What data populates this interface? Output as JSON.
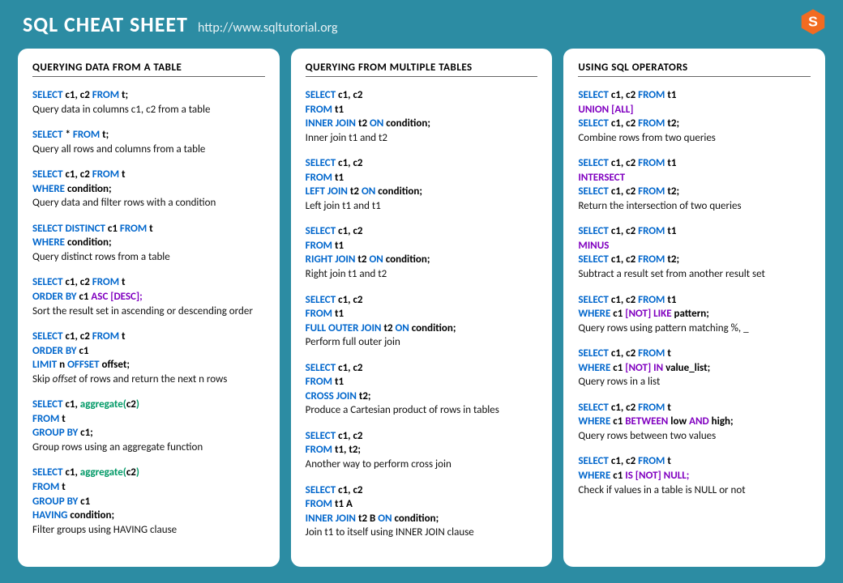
{
  "header": {
    "title": "SQL CHEAT SHEET",
    "url": "http://www.sqltutorial.org"
  },
  "columns": [
    {
      "heading": "QUERYING DATA FROM A TABLE",
      "blocks": [
        {
          "code": [
            [
              {
                "t": "SELECT ",
                "c": "kw"
              },
              {
                "t": "c1, c2 ",
                "c": "blk"
              },
              {
                "t": "FROM ",
                "c": "kw"
              },
              {
                "t": "t;",
                "c": "blk"
              }
            ]
          ],
          "desc": "Query data in columns c1, c2 from a table"
        },
        {
          "code": [
            [
              {
                "t": "SELECT ",
                "c": "kw"
              },
              {
                "t": "* ",
                "c": "blk"
              },
              {
                "t": "FROM ",
                "c": "kw"
              },
              {
                "t": "t;",
                "c": "blk"
              }
            ]
          ],
          "desc": "Query all rows and columns from a table"
        },
        {
          "code": [
            [
              {
                "t": "SELECT ",
                "c": "kw"
              },
              {
                "t": "c1, c2 ",
                "c": "blk"
              },
              {
                "t": "FROM ",
                "c": "kw"
              },
              {
                "t": "t",
                "c": "blk"
              }
            ],
            [
              {
                "t": "WHERE ",
                "c": "kw"
              },
              {
                "t": "condition;",
                "c": "blk"
              }
            ]
          ],
          "desc": "Query data and filter rows with a condition"
        },
        {
          "code": [
            [
              {
                "t": "SELECT DISTINCT ",
                "c": "kw"
              },
              {
                "t": "c1 ",
                "c": "blk"
              },
              {
                "t": "FROM ",
                "c": "kw"
              },
              {
                "t": "t",
                "c": "blk"
              }
            ],
            [
              {
                "t": "WHERE ",
                "c": "kw"
              },
              {
                "t": "condition;",
                "c": "blk"
              }
            ]
          ],
          "desc": "Query distinct rows from a table"
        },
        {
          "code": [
            [
              {
                "t": "SELECT ",
                "c": "kw"
              },
              {
                "t": "c1, c2 ",
                "c": "blk"
              },
              {
                "t": "FROM ",
                "c": "kw"
              },
              {
                "t": "t",
                "c": "blk"
              }
            ],
            [
              {
                "t": "ORDER BY ",
                "c": "kw"
              },
              {
                "t": "c1 ",
                "c": "blk"
              },
              {
                "t": "ASC [DESC];",
                "c": "op"
              }
            ]
          ],
          "desc": "Sort the result set in ascending or descending order"
        },
        {
          "code": [
            [
              {
                "t": "SELECT ",
                "c": "kw"
              },
              {
                "t": "c1, c2 ",
                "c": "blk"
              },
              {
                "t": "FROM ",
                "c": "kw"
              },
              {
                "t": "t",
                "c": "blk"
              }
            ],
            [
              {
                "t": "ORDER BY ",
                "c": "kw"
              },
              {
                "t": "c1",
                "c": "blk"
              }
            ],
            [
              {
                "t": "LIMIT ",
                "c": "kw"
              },
              {
                "t": "n ",
                "c": "blk"
              },
              {
                "t": "OFFSET ",
                "c": "kw"
              },
              {
                "t": "offset;",
                "c": "blk"
              }
            ]
          ],
          "desc": "Skip <em>offset</em> of rows and return the next n rows"
        },
        {
          "code": [
            [
              {
                "t": "SELECT ",
                "c": "kw"
              },
              {
                "t": "c1, ",
                "c": "blk"
              },
              {
                "t": "aggregate(",
                "c": "fn"
              },
              {
                "t": "c2",
                "c": "blk"
              },
              {
                "t": ")",
                "c": "fn"
              }
            ],
            [
              {
                "t": "FROM ",
                "c": "kw"
              },
              {
                "t": "t",
                "c": "blk"
              }
            ],
            [
              {
                "t": "GROUP BY ",
                "c": "kw"
              },
              {
                "t": "c1;",
                "c": "blk"
              }
            ]
          ],
          "desc": "Group rows using an aggregate function"
        },
        {
          "code": [
            [
              {
                "t": "SELECT ",
                "c": "kw"
              },
              {
                "t": "c1, ",
                "c": "blk"
              },
              {
                "t": "aggregate(",
                "c": "fn"
              },
              {
                "t": "c2",
                "c": "blk"
              },
              {
                "t": ")",
                "c": "fn"
              }
            ],
            [
              {
                "t": "FROM ",
                "c": "kw"
              },
              {
                "t": "t",
                "c": "blk"
              }
            ],
            [
              {
                "t": "GROUP BY ",
                "c": "kw"
              },
              {
                "t": "c1",
                "c": "blk"
              }
            ],
            [
              {
                "t": "HAVING ",
                "c": "kw"
              },
              {
                "t": "condition;",
                "c": "blk"
              }
            ]
          ],
          "desc": "Filter groups using HAVING clause"
        }
      ]
    },
    {
      "heading": "QUERYING FROM MULTIPLE TABLES",
      "blocks": [
        {
          "code": [
            [
              {
                "t": "SELECT ",
                "c": "kw"
              },
              {
                "t": "c1, c2",
                "c": "blk"
              }
            ],
            [
              {
                "t": "FROM ",
                "c": "kw"
              },
              {
                "t": "t1",
                "c": "blk"
              }
            ],
            [
              {
                "t": "INNER JOIN ",
                "c": "kw"
              },
              {
                "t": "t2 ",
                "c": "blk"
              },
              {
                "t": "ON ",
                "c": "kw"
              },
              {
                "t": "condition;",
                "c": "blk"
              }
            ]
          ],
          "desc": "Inner join t1 and t2"
        },
        {
          "code": [
            [
              {
                "t": "SELECT ",
                "c": "kw"
              },
              {
                "t": "c1, c2",
                "c": "blk"
              }
            ],
            [
              {
                "t": "FROM ",
                "c": "kw"
              },
              {
                "t": "t1",
                "c": "blk"
              }
            ],
            [
              {
                "t": "LEFT JOIN ",
                "c": "kw"
              },
              {
                "t": "t2 ",
                "c": "blk"
              },
              {
                "t": "ON ",
                "c": "kw"
              },
              {
                "t": "condition;",
                "c": "blk"
              }
            ]
          ],
          "desc": "Left join t1 and t1"
        },
        {
          "code": [
            [
              {
                "t": "SELECT ",
                "c": "kw"
              },
              {
                "t": "c1, c2",
                "c": "blk"
              }
            ],
            [
              {
                "t": "FROM ",
                "c": "kw"
              },
              {
                "t": "t1",
                "c": "blk"
              }
            ],
            [
              {
                "t": "RIGHT JOIN ",
                "c": "kw"
              },
              {
                "t": "t2 ",
                "c": "blk"
              },
              {
                "t": "ON ",
                "c": "kw"
              },
              {
                "t": "condition;",
                "c": "blk"
              }
            ]
          ],
          "desc": "Right join t1 and t2"
        },
        {
          "code": [
            [
              {
                "t": "SELECT ",
                "c": "kw"
              },
              {
                "t": "c1, c2",
                "c": "blk"
              }
            ],
            [
              {
                "t": "FROM ",
                "c": "kw"
              },
              {
                "t": "t1",
                "c": "blk"
              }
            ],
            [
              {
                "t": "FULL OUTER JOIN ",
                "c": "kw"
              },
              {
                "t": "t2 ",
                "c": "blk"
              },
              {
                "t": "ON ",
                "c": "kw"
              },
              {
                "t": "condition;",
                "c": "blk"
              }
            ]
          ],
          "desc": "Perform full outer join"
        },
        {
          "code": [
            [
              {
                "t": "SELECT ",
                "c": "kw"
              },
              {
                "t": "c1, c2",
                "c": "blk"
              }
            ],
            [
              {
                "t": "FROM ",
                "c": "kw"
              },
              {
                "t": "t1",
                "c": "blk"
              }
            ],
            [
              {
                "t": "CROSS JOIN ",
                "c": "kw"
              },
              {
                "t": "t2;",
                "c": "blk"
              }
            ]
          ],
          "desc": "Produce a Cartesian product of rows in tables"
        },
        {
          "code": [
            [
              {
                "t": "SELECT ",
                "c": "kw"
              },
              {
                "t": "c1, c2",
                "c": "blk"
              }
            ],
            [
              {
                "t": "FROM ",
                "c": "kw"
              },
              {
                "t": "t1, t2;",
                "c": "blk"
              }
            ]
          ],
          "desc": "Another way to perform cross join"
        },
        {
          "code": [
            [
              {
                "t": "SELECT ",
                "c": "kw"
              },
              {
                "t": "c1, c2",
                "c": "blk"
              }
            ],
            [
              {
                "t": "FROM ",
                "c": "kw"
              },
              {
                "t": "t1 A",
                "c": "blk"
              }
            ],
            [
              {
                "t": "INNER JOIN ",
                "c": "kw"
              },
              {
                "t": "t2 B ",
                "c": "blk"
              },
              {
                "t": "ON ",
                "c": "kw"
              },
              {
                "t": "condition;",
                "c": "blk"
              }
            ]
          ],
          "desc": "Join t1 to itself using INNER JOIN clause"
        }
      ]
    },
    {
      "heading": "USING SQL OPERATORS",
      "blocks": [
        {
          "code": [
            [
              {
                "t": "SELECT ",
                "c": "kw"
              },
              {
                "t": "c1, c2 ",
                "c": "blk"
              },
              {
                "t": "FROM ",
                "c": "kw"
              },
              {
                "t": "t1",
                "c": "blk"
              }
            ],
            [
              {
                "t": "UNION [ALL]",
                "c": "op"
              }
            ],
            [
              {
                "t": "SELECT ",
                "c": "kw"
              },
              {
                "t": "c1, c2 ",
                "c": "blk"
              },
              {
                "t": "FROM ",
                "c": "kw"
              },
              {
                "t": "t2;",
                "c": "blk"
              }
            ]
          ],
          "desc": "Combine rows from two queries"
        },
        {
          "code": [
            [
              {
                "t": "SELECT ",
                "c": "kw"
              },
              {
                "t": "c1, c2 ",
                "c": "blk"
              },
              {
                "t": "FROM ",
                "c": "kw"
              },
              {
                "t": "t1",
                "c": "blk"
              }
            ],
            [
              {
                "t": "INTERSECT",
                "c": "op"
              }
            ],
            [
              {
                "t": "SELECT ",
                "c": "kw"
              },
              {
                "t": "c1, c2 ",
                "c": "blk"
              },
              {
                "t": "FROM ",
                "c": "kw"
              },
              {
                "t": "t2;",
                "c": "blk"
              }
            ]
          ],
          "desc": "Return the intersection of two queries"
        },
        {
          "code": [
            [
              {
                "t": "SELECT ",
                "c": "kw"
              },
              {
                "t": "c1, c2 ",
                "c": "blk"
              },
              {
                "t": "FROM ",
                "c": "kw"
              },
              {
                "t": "t1",
                "c": "blk"
              }
            ],
            [
              {
                "t": "MINUS",
                "c": "op"
              }
            ],
            [
              {
                "t": "SELECT ",
                "c": "kw"
              },
              {
                "t": "c1, c2 ",
                "c": "blk"
              },
              {
                "t": "FROM ",
                "c": "kw"
              },
              {
                "t": "t2;",
                "c": "blk"
              }
            ]
          ],
          "desc": "Subtract a result set from another result set"
        },
        {
          "code": [
            [
              {
                "t": "SELECT ",
                "c": "kw"
              },
              {
                "t": "c1, c2 ",
                "c": "blk"
              },
              {
                "t": "FROM ",
                "c": "kw"
              },
              {
                "t": "t1",
                "c": "blk"
              }
            ],
            [
              {
                "t": "WHERE ",
                "c": "kw"
              },
              {
                "t": "c1 ",
                "c": "blk"
              },
              {
                "t": "[NOT] LIKE ",
                "c": "op"
              },
              {
                "t": "pattern;",
                "c": "blk"
              }
            ]
          ],
          "desc": "Query rows using pattern matching %, _"
        },
        {
          "code": [
            [
              {
                "t": "SELECT ",
                "c": "kw"
              },
              {
                "t": "c1, c2 ",
                "c": "blk"
              },
              {
                "t": "FROM ",
                "c": "kw"
              },
              {
                "t": "t",
                "c": "blk"
              }
            ],
            [
              {
                "t": "WHERE ",
                "c": "kw"
              },
              {
                "t": "c1 ",
                "c": "blk"
              },
              {
                "t": "[NOT] IN ",
                "c": "op"
              },
              {
                "t": "value_list;",
                "c": "blk"
              }
            ]
          ],
          "desc": "Query rows in a list"
        },
        {
          "code": [
            [
              {
                "t": "SELECT ",
                "c": "kw"
              },
              {
                "t": "c1, c2 ",
                "c": "blk"
              },
              {
                "t": "FROM ",
                "c": "kw"
              },
              {
                "t": "t",
                "c": "blk"
              }
            ],
            [
              {
                "t": "WHERE  ",
                "c": "kw"
              },
              {
                "t": "c1 ",
                "c": "blk"
              },
              {
                "t": "BETWEEN ",
                "c": "op"
              },
              {
                "t": "low ",
                "c": "blk"
              },
              {
                "t": "AND ",
                "c": "op"
              },
              {
                "t": "high;",
                "c": "blk"
              }
            ]
          ],
          "desc": "Query rows between two values"
        },
        {
          "code": [
            [
              {
                "t": "SELECT ",
                "c": "kw"
              },
              {
                "t": "c1, c2 ",
                "c": "blk"
              },
              {
                "t": "FROM ",
                "c": "kw"
              },
              {
                "t": "t",
                "c": "blk"
              }
            ],
            [
              {
                "t": "WHERE  ",
                "c": "kw"
              },
              {
                "t": "c1 ",
                "c": "blk"
              },
              {
                "t": "IS [NOT] NULL;",
                "c": "op"
              }
            ]
          ],
          "desc": "Check if values in a table is NULL or not"
        }
      ]
    }
  ]
}
